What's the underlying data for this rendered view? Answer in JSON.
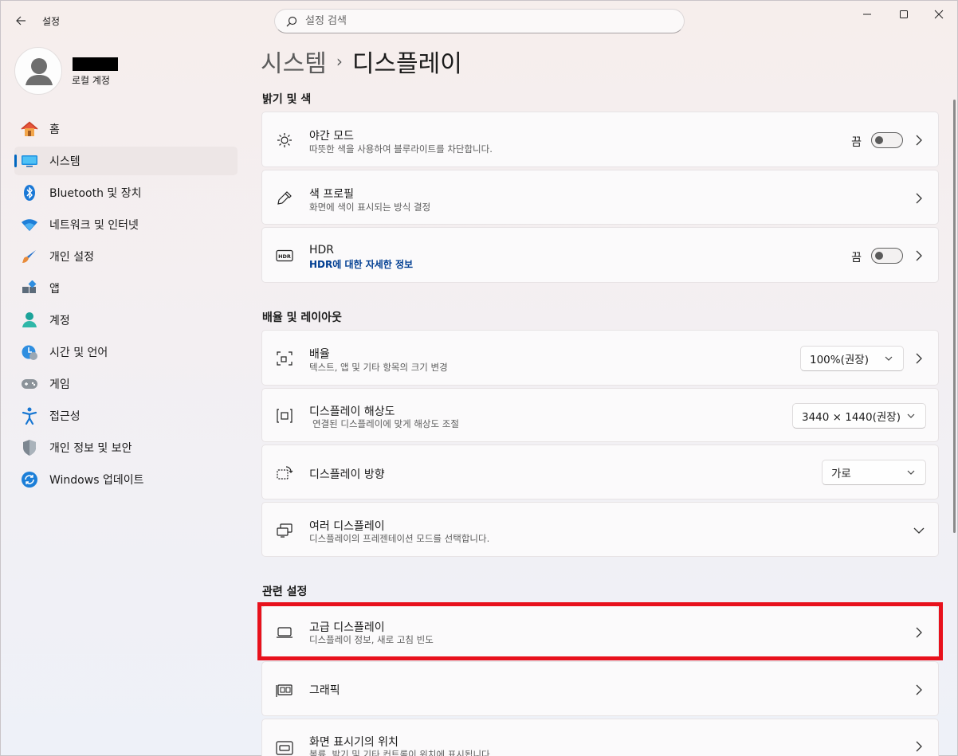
{
  "app": {
    "title": "설정"
  },
  "search": {
    "placeholder": "설정 검색"
  },
  "profile": {
    "account": "로컬 계정"
  },
  "sidebar": {
    "items": [
      {
        "label": "홈",
        "icon": "home-icon"
      },
      {
        "label": "시스템",
        "icon": "system-icon",
        "active": true
      },
      {
        "label": "Bluetooth 및 장치",
        "icon": "bluetooth-icon"
      },
      {
        "label": "네트워크 및 인터넷",
        "icon": "wifi-icon"
      },
      {
        "label": "개인 설정",
        "icon": "brush-icon"
      },
      {
        "label": "앱",
        "icon": "apps-icon"
      },
      {
        "label": "계정",
        "icon": "account-icon"
      },
      {
        "label": "시간 및 언어",
        "icon": "time-language-icon"
      },
      {
        "label": "게임",
        "icon": "gamepad-icon"
      },
      {
        "label": "접근성",
        "icon": "accessibility-icon"
      },
      {
        "label": "개인 정보 및 보안",
        "icon": "shield-icon"
      },
      {
        "label": "Windows 업데이트",
        "icon": "update-icon"
      }
    ]
  },
  "breadcrumb": {
    "parent": "시스템",
    "separator": "›",
    "current": "디스플레이"
  },
  "sections": {
    "brightness": {
      "title": "밝기 및 색",
      "night_light": {
        "title": "야간 모드",
        "sub": "따뜻한 색을 사용하여 블루라이트를 차단합니다.",
        "toggle_label": "끔"
      },
      "color_profile": {
        "title": "색 프로필",
        "sub": "화면에 색이 표시되는 방식 결정"
      },
      "hdr": {
        "title": "HDR",
        "link": "HDR에 대한 자세한 정보",
        "toggle_label": "끔"
      }
    },
    "scale_layout": {
      "title": "배율 및 레이아웃",
      "scale": {
        "title": "배율",
        "sub": "텍스트, 앱 및 기타 항목의 크기 변경",
        "value": "100%(권장)"
      },
      "resolution": {
        "title": "디스플레이 해상도",
        "sub": "연결된 디스플레이에 맞게 해상도 조절",
        "value": "3440 × 1440(권장)"
      },
      "orientation": {
        "title": "디스플레이 방향",
        "value": "가로"
      },
      "multiple": {
        "title": "여러 디스플레이",
        "sub": "디스플레이의 프레젠테이션 모드를 선택합니다."
      }
    },
    "related": {
      "title": "관련 설정",
      "advanced": {
        "title": "고급 디스플레이",
        "sub": "디스플레이 정보, 새로 고침 빈도"
      },
      "graphics": {
        "title": "그래픽"
      },
      "taskbar_position": {
        "title": "화면 표시기의 위치",
        "sub": "볼륨, 밝기 및 기타 컨트롤이 위치에 표시됩니다."
      }
    }
  },
  "colors": {
    "accent": "#0067c0",
    "highlight": "#e8111c"
  }
}
